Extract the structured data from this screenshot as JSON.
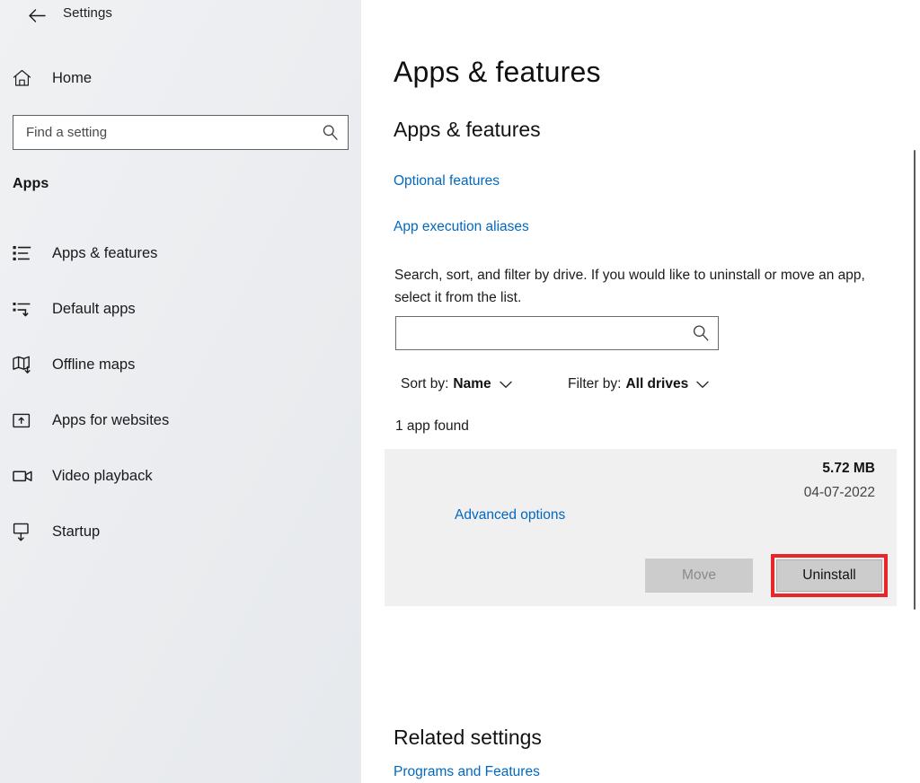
{
  "window": {
    "title": "Settings",
    "back_icon": "back-arrow-icon",
    "controls": {
      "minimize": "minimize-icon",
      "maximize": "maximize-icon",
      "close": "close-icon"
    }
  },
  "sidebar": {
    "home": {
      "label": "Home",
      "icon": "home-icon"
    },
    "search": {
      "placeholder": "Find a setting",
      "value": "",
      "icon": "search-icon"
    },
    "section_title": "Apps",
    "items": [
      {
        "label": "Apps & features",
        "icon": "list-bullets-icon",
        "selected": true
      },
      {
        "label": "Default apps",
        "icon": "list-default-icon",
        "selected": false
      },
      {
        "label": "Offline maps",
        "icon": "map-download-icon",
        "selected": false
      },
      {
        "label": "Apps for websites",
        "icon": "window-arrow-icon",
        "selected": false
      },
      {
        "label": "Video playback",
        "icon": "video-camera-icon",
        "selected": false
      },
      {
        "label": "Startup",
        "icon": "monitor-startup-icon",
        "selected": false
      }
    ]
  },
  "main": {
    "page_title": "Apps & features",
    "section_heading": "Apps & features",
    "links": [
      {
        "label": "Optional features"
      },
      {
        "label": "App execution aliases"
      }
    ],
    "description": "Search, sort, and filter by drive. If you would like to uninstall or move an app, select it from the list.",
    "app_search": {
      "placeholder": "",
      "value": "",
      "icon": "search-icon"
    },
    "filters": {
      "sort": {
        "label": "Sort by:",
        "value": "Name",
        "chevron": "chevron-down-icon"
      },
      "drive": {
        "label": "Filter by:",
        "value": "All drives",
        "chevron": "chevron-down-icon"
      }
    },
    "app_count": "1 app found",
    "app_card": {
      "size": "5.72 MB",
      "date": "04-07-2022",
      "advanced_options": "Advanced options",
      "move_button": "Move",
      "uninstall_button": "Uninstall",
      "highlight_color": "#e8252a"
    },
    "related": {
      "heading": "Related settings",
      "link": "Programs and Features"
    }
  },
  "colors": {
    "accent_link": "#0268c0",
    "highlight": "#e8252a",
    "sidebar_bg": "#ebedf0",
    "card_bg": "#f0f0f0",
    "button_bg": "#cccccc"
  }
}
